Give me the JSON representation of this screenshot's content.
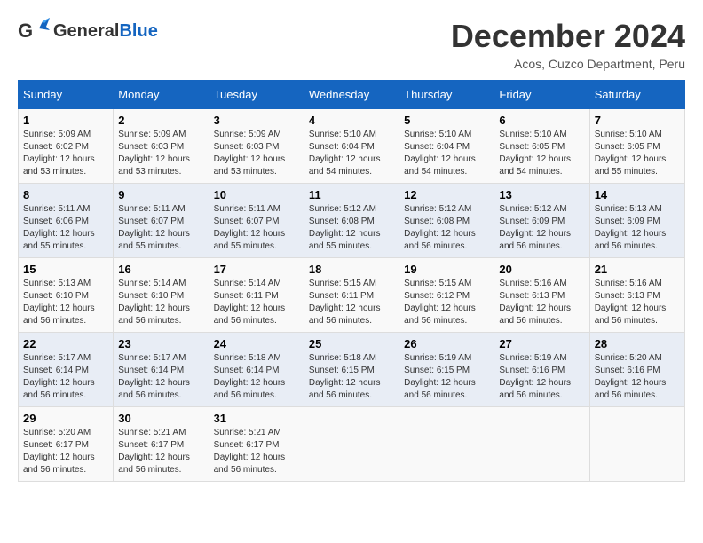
{
  "logo": {
    "general": "General",
    "blue": "Blue"
  },
  "title": "December 2024",
  "location": "Acos, Cuzco Department, Peru",
  "days_header": [
    "Sunday",
    "Monday",
    "Tuesday",
    "Wednesday",
    "Thursday",
    "Friday",
    "Saturday"
  ],
  "weeks": [
    [
      {
        "day": "1",
        "info": "Sunrise: 5:09 AM\nSunset: 6:02 PM\nDaylight: 12 hours\nand 53 minutes."
      },
      {
        "day": "2",
        "info": "Sunrise: 5:09 AM\nSunset: 6:03 PM\nDaylight: 12 hours\nand 53 minutes."
      },
      {
        "day": "3",
        "info": "Sunrise: 5:09 AM\nSunset: 6:03 PM\nDaylight: 12 hours\nand 53 minutes."
      },
      {
        "day": "4",
        "info": "Sunrise: 5:10 AM\nSunset: 6:04 PM\nDaylight: 12 hours\nand 54 minutes."
      },
      {
        "day": "5",
        "info": "Sunrise: 5:10 AM\nSunset: 6:04 PM\nDaylight: 12 hours\nand 54 minutes."
      },
      {
        "day": "6",
        "info": "Sunrise: 5:10 AM\nSunset: 6:05 PM\nDaylight: 12 hours\nand 54 minutes."
      },
      {
        "day": "7",
        "info": "Sunrise: 5:10 AM\nSunset: 6:05 PM\nDaylight: 12 hours\nand 55 minutes."
      }
    ],
    [
      {
        "day": "8",
        "info": "Sunrise: 5:11 AM\nSunset: 6:06 PM\nDaylight: 12 hours\nand 55 minutes."
      },
      {
        "day": "9",
        "info": "Sunrise: 5:11 AM\nSunset: 6:07 PM\nDaylight: 12 hours\nand 55 minutes."
      },
      {
        "day": "10",
        "info": "Sunrise: 5:11 AM\nSunset: 6:07 PM\nDaylight: 12 hours\nand 55 minutes."
      },
      {
        "day": "11",
        "info": "Sunrise: 5:12 AM\nSunset: 6:08 PM\nDaylight: 12 hours\nand 55 minutes."
      },
      {
        "day": "12",
        "info": "Sunrise: 5:12 AM\nSunset: 6:08 PM\nDaylight: 12 hours\nand 56 minutes."
      },
      {
        "day": "13",
        "info": "Sunrise: 5:12 AM\nSunset: 6:09 PM\nDaylight: 12 hours\nand 56 minutes."
      },
      {
        "day": "14",
        "info": "Sunrise: 5:13 AM\nSunset: 6:09 PM\nDaylight: 12 hours\nand 56 minutes."
      }
    ],
    [
      {
        "day": "15",
        "info": "Sunrise: 5:13 AM\nSunset: 6:10 PM\nDaylight: 12 hours\nand 56 minutes."
      },
      {
        "day": "16",
        "info": "Sunrise: 5:14 AM\nSunset: 6:10 PM\nDaylight: 12 hours\nand 56 minutes."
      },
      {
        "day": "17",
        "info": "Sunrise: 5:14 AM\nSunset: 6:11 PM\nDaylight: 12 hours\nand 56 minutes."
      },
      {
        "day": "18",
        "info": "Sunrise: 5:15 AM\nSunset: 6:11 PM\nDaylight: 12 hours\nand 56 minutes."
      },
      {
        "day": "19",
        "info": "Sunrise: 5:15 AM\nSunset: 6:12 PM\nDaylight: 12 hours\nand 56 minutes."
      },
      {
        "day": "20",
        "info": "Sunrise: 5:16 AM\nSunset: 6:13 PM\nDaylight: 12 hours\nand 56 minutes."
      },
      {
        "day": "21",
        "info": "Sunrise: 5:16 AM\nSunset: 6:13 PM\nDaylight: 12 hours\nand 56 minutes."
      }
    ],
    [
      {
        "day": "22",
        "info": "Sunrise: 5:17 AM\nSunset: 6:14 PM\nDaylight: 12 hours\nand 56 minutes."
      },
      {
        "day": "23",
        "info": "Sunrise: 5:17 AM\nSunset: 6:14 PM\nDaylight: 12 hours\nand 56 minutes."
      },
      {
        "day": "24",
        "info": "Sunrise: 5:18 AM\nSunset: 6:14 PM\nDaylight: 12 hours\nand 56 minutes."
      },
      {
        "day": "25",
        "info": "Sunrise: 5:18 AM\nSunset: 6:15 PM\nDaylight: 12 hours\nand 56 minutes."
      },
      {
        "day": "26",
        "info": "Sunrise: 5:19 AM\nSunset: 6:15 PM\nDaylight: 12 hours\nand 56 minutes."
      },
      {
        "day": "27",
        "info": "Sunrise: 5:19 AM\nSunset: 6:16 PM\nDaylight: 12 hours\nand 56 minutes."
      },
      {
        "day": "28",
        "info": "Sunrise: 5:20 AM\nSunset: 6:16 PM\nDaylight: 12 hours\nand 56 minutes."
      }
    ],
    [
      {
        "day": "29",
        "info": "Sunrise: 5:20 AM\nSunset: 6:17 PM\nDaylight: 12 hours\nand 56 minutes."
      },
      {
        "day": "30",
        "info": "Sunrise: 5:21 AM\nSunset: 6:17 PM\nDaylight: 12 hours\nand 56 minutes."
      },
      {
        "day": "31",
        "info": "Sunrise: 5:21 AM\nSunset: 6:17 PM\nDaylight: 12 hours\nand 56 minutes."
      },
      {
        "day": "",
        "info": ""
      },
      {
        "day": "",
        "info": ""
      },
      {
        "day": "",
        "info": ""
      },
      {
        "day": "",
        "info": ""
      }
    ]
  ]
}
